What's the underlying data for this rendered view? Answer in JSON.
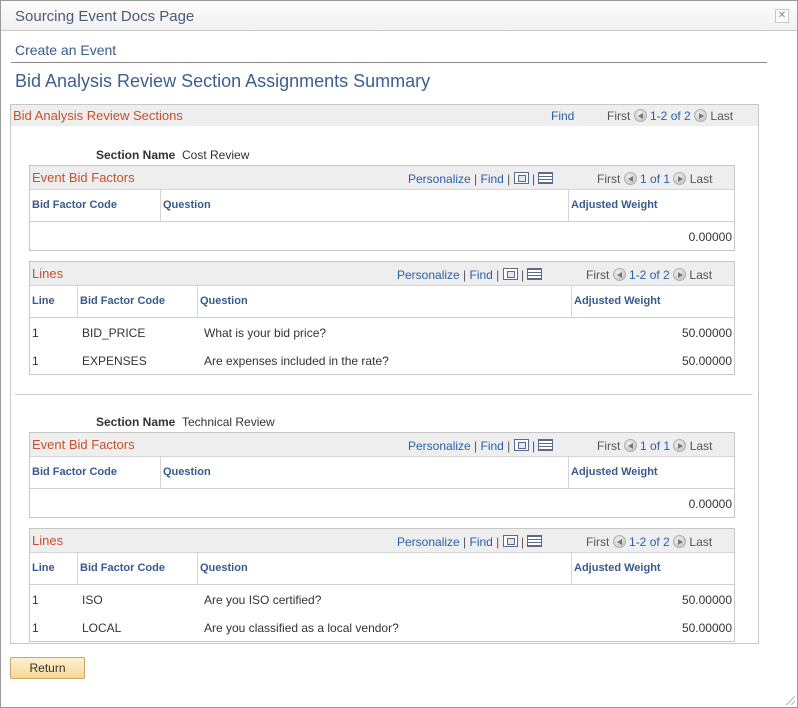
{
  "window": {
    "title": "Sourcing Event Docs Page"
  },
  "breadcrumb": "Create an Event",
  "page_title": "Bid Analysis Review Section Assignments Summary",
  "outer_grid": {
    "title": "Bid Analysis Review Sections",
    "find": "Find",
    "first": "First",
    "range": "1-2 of 2",
    "last": "Last"
  },
  "sections": [
    {
      "label": "Section Name",
      "value": "Cost Review",
      "factors": {
        "title": "Event Bid Factors",
        "personalize": "Personalize",
        "find": "Find",
        "first": "First",
        "range": "1 of 1",
        "last": "Last",
        "columns": [
          "Bid Factor Code",
          "Question",
          "Adjusted Weight"
        ],
        "rows": [
          {
            "code": "",
            "question": "",
            "weight": "0.00000"
          }
        ]
      },
      "lines": {
        "title": "Lines",
        "personalize": "Personalize",
        "find": "Find",
        "first": "First",
        "range": "1-2 of 2",
        "last": "Last",
        "columns": [
          "Line",
          "Bid Factor Code",
          "Question",
          "Adjusted Weight"
        ],
        "rows": [
          {
            "line": "1",
            "code": "BID_PRICE",
            "question": "What is your bid price?",
            "weight": "50.00000"
          },
          {
            "line": "1",
            "code": "EXPENSES",
            "question": "Are expenses included in the rate?",
            "weight": "50.00000"
          }
        ]
      }
    },
    {
      "label": "Section Name",
      "value": "Technical Review",
      "factors": {
        "title": "Event Bid Factors",
        "personalize": "Personalize",
        "find": "Find",
        "first": "First",
        "range": "1 of 1",
        "last": "Last",
        "columns": [
          "Bid Factor Code",
          "Question",
          "Adjusted Weight"
        ],
        "rows": [
          {
            "code": "",
            "question": "",
            "weight": "0.00000"
          }
        ]
      },
      "lines": {
        "title": "Lines",
        "personalize": "Personalize",
        "find": "Find",
        "first": "First",
        "range": "1-2 of 2",
        "last": "Last",
        "columns": [
          "Line",
          "Bid Factor Code",
          "Question",
          "Adjusted Weight"
        ],
        "rows": [
          {
            "line": "1",
            "code": "ISO",
            "question": "Are you ISO certified?",
            "weight": "50.00000"
          },
          {
            "line": "1",
            "code": "LOCAL",
            "question": "Are you classified as a local vendor?",
            "weight": "50.00000"
          }
        ]
      }
    }
  ],
  "buttons": {
    "return": "Return",
    "close": "✕"
  },
  "icons": [
    "close-icon",
    "zoom-icon",
    "download-icon",
    "prev-arrow-icon",
    "next-arrow-icon"
  ],
  "colors": {
    "grid_title": "#c8502c",
    "link": "#2a5ea8",
    "header_link": "#3a5a8c",
    "button": "#f6d793"
  }
}
